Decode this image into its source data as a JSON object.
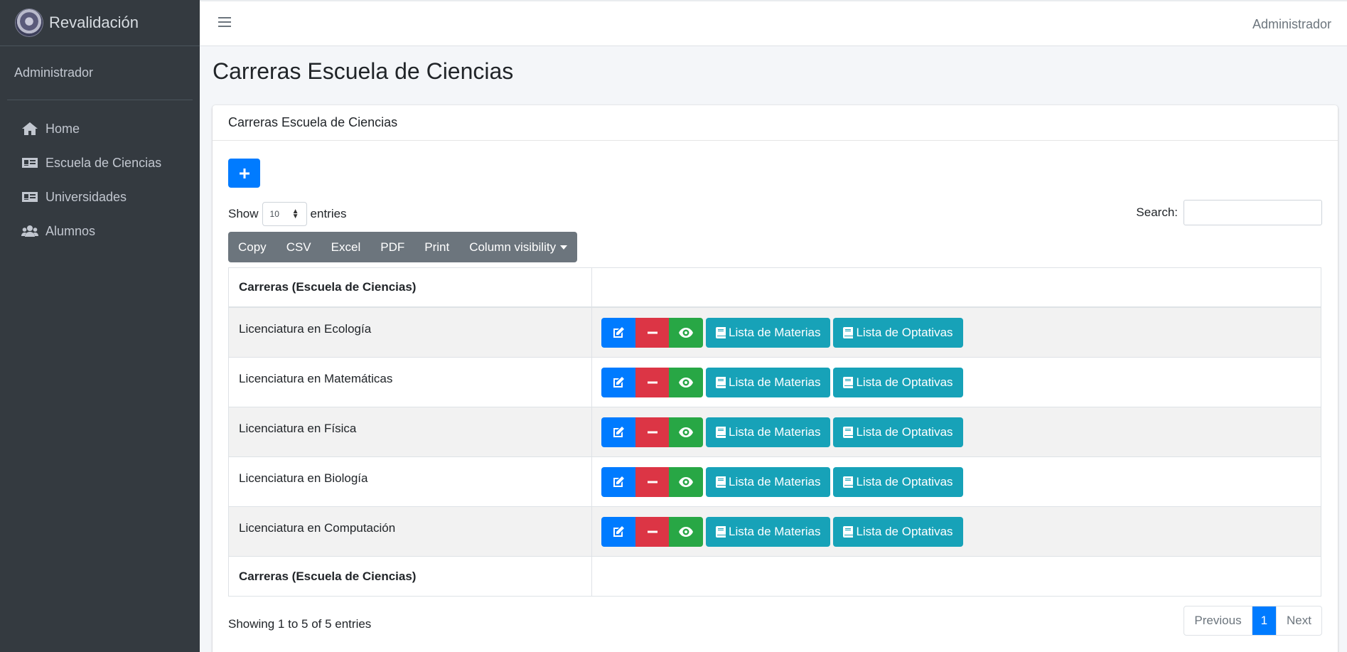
{
  "brand": {
    "name": "Revalidación"
  },
  "sidebar": {
    "user": "Administrador",
    "items": [
      {
        "label": "Home",
        "icon": "home-icon"
      },
      {
        "label": "Escuela de Ciencias",
        "icon": "id-card-icon"
      },
      {
        "label": "Universidades",
        "icon": "id-card-icon"
      },
      {
        "label": "Alumnos",
        "icon": "users-icon"
      }
    ]
  },
  "topbar": {
    "user": "Administrador"
  },
  "page": {
    "title": "Carreras Escuela de Ciencias"
  },
  "card": {
    "header": "Carreras Escuela de Ciencias",
    "show_label": "Show",
    "entries_label": "entries",
    "page_length": "10",
    "search_label": "Search:",
    "search_value": "",
    "export_buttons": {
      "copy": "Copy",
      "csv": "CSV",
      "excel": "Excel",
      "pdf": "PDF",
      "print": "Print",
      "colvis": "Column visibility"
    }
  },
  "table": {
    "header": "Carreras (Escuela de Ciencias)",
    "footer": "Carreras (Escuela de Ciencias)",
    "rows": [
      {
        "name": "Licenciatura en Ecología"
      },
      {
        "name": "Licenciatura en Matemáticas"
      },
      {
        "name": "Licenciatura en Física"
      },
      {
        "name": "Licenciatura en Biología"
      },
      {
        "name": "Licenciatura en Computación"
      }
    ],
    "materias_label": "Lista de Materias",
    "optativas_label": "Lista de Optativas"
  },
  "footer": {
    "info": "Showing 1 to 5 of 5 entries",
    "previous": "Previous",
    "current_page": "1",
    "next": "Next"
  },
  "colors": {
    "primary": "#007bff",
    "danger": "#dc3545",
    "success": "#28a745",
    "info": "#17a2b8",
    "secondary": "#6c757d",
    "sidebar": "#343a40"
  }
}
